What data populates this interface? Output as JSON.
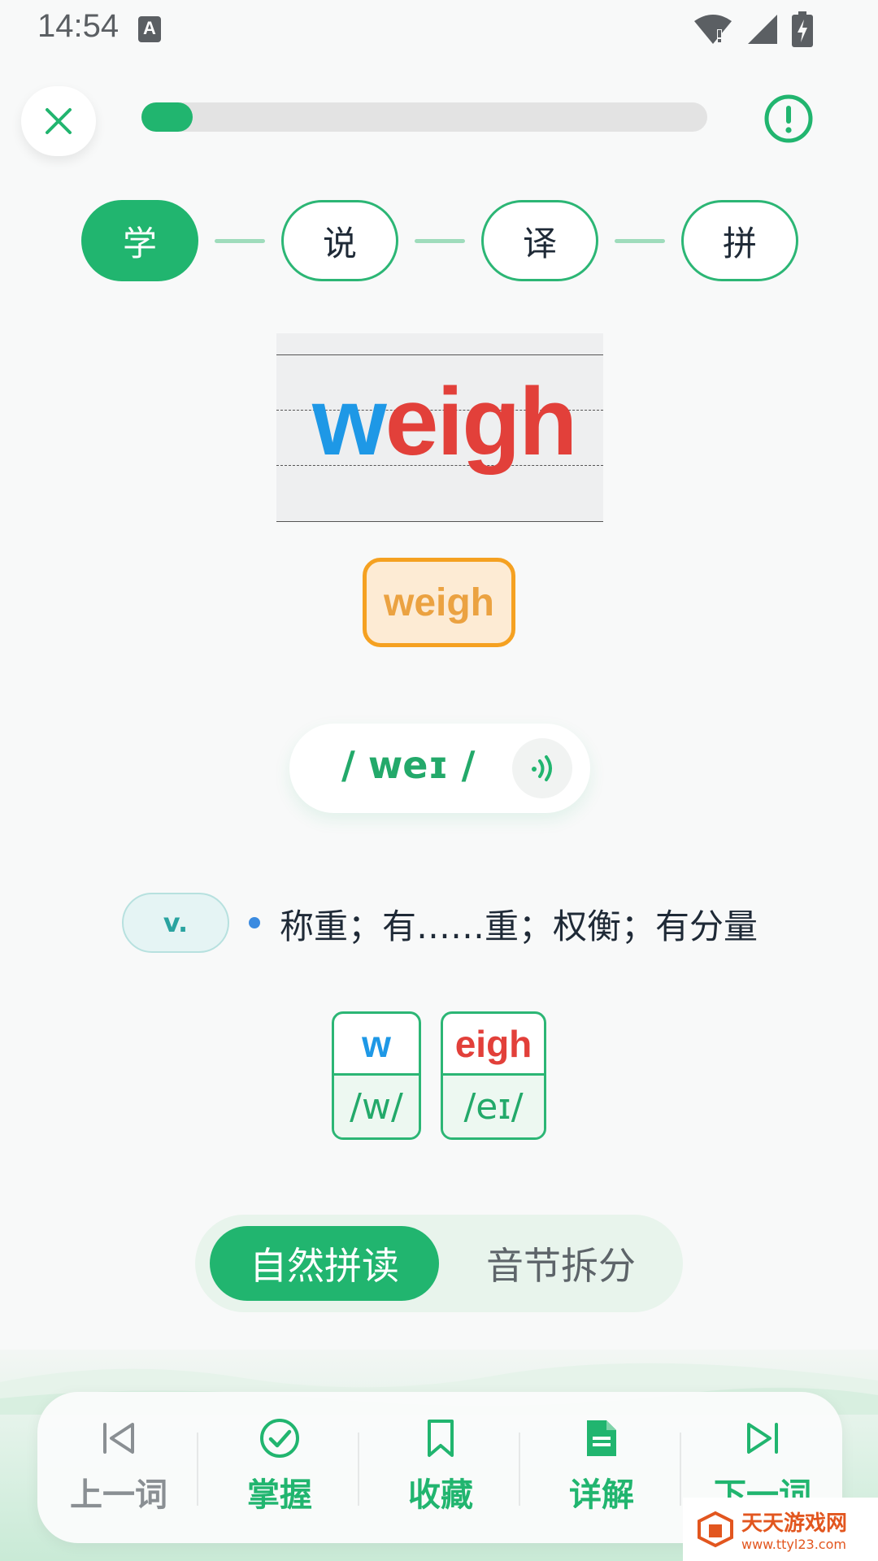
{
  "status_bar": {
    "time": "14:54",
    "notif_badge": "A"
  },
  "progress": {
    "value": 0.09,
    "fill_color": "#21b56f"
  },
  "steps": [
    {
      "label": "学",
      "active": true
    },
    {
      "label": "说",
      "active": false
    },
    {
      "label": "译",
      "active": false
    },
    {
      "label": "拼",
      "active": false
    }
  ],
  "word": {
    "prefix": "w",
    "rest": "eigh",
    "prefix_color": "#1e98e6",
    "rest_color": "#e2403a",
    "chip_label": "weigh"
  },
  "phonetic": {
    "text": "/ weɪ /"
  },
  "definition": {
    "pos": "v.",
    "meaning": "称重；有……重；权衡；有分量"
  },
  "phonics": [
    {
      "letters": "w",
      "sound": "/w/",
      "color": "#1e98e6"
    },
    {
      "letters": "eigh",
      "sound": "/eɪ/",
      "color": "#e2403a"
    }
  ],
  "mode_toggle": {
    "active_label": "自然拼读",
    "inactive_label": "音节拆分"
  },
  "bottom_nav": [
    {
      "label": "上一词",
      "icon": "previous-icon",
      "color": "#8a8f93"
    },
    {
      "label": "掌握",
      "icon": "check-circle-icon",
      "color": "#21b56f"
    },
    {
      "label": "收藏",
      "icon": "bookmark-icon",
      "color": "#21b56f"
    },
    {
      "label": "详解",
      "icon": "document-icon",
      "color": "#21b56f"
    },
    {
      "label": "下一词",
      "icon": "next-icon",
      "color": "#21b56f"
    }
  ],
  "watermark": {
    "title": "天天游戏网",
    "url": "www.ttyl23.com"
  }
}
